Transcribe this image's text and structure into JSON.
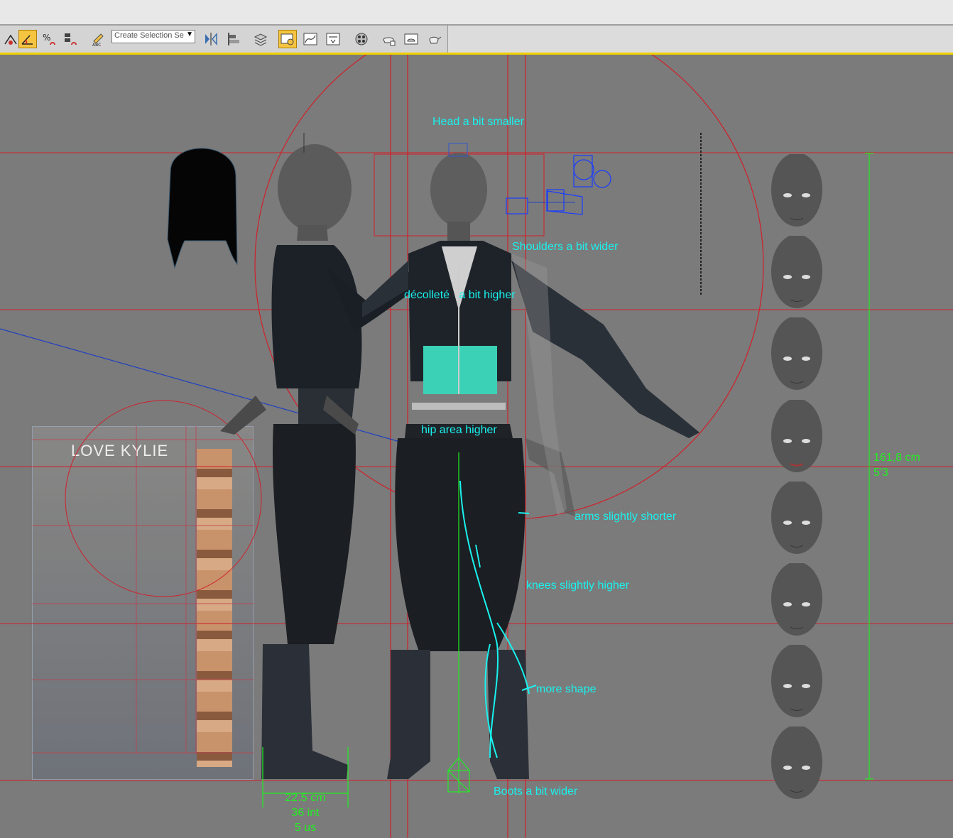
{
  "toolbar": {
    "selection_set_placeholder": "Create Selection Se",
    "tools": [
      {
        "name": "snap-2d-icon"
      },
      {
        "name": "angle-snap-icon"
      },
      {
        "name": "percent-snap-icon"
      },
      {
        "name": "spinner-snap-icon"
      },
      {
        "name": "edit-named-selection-icon"
      },
      {
        "name": "mirror-icon"
      },
      {
        "name": "align-icon"
      },
      {
        "name": "layer-manager-icon"
      },
      {
        "name": "scene-explorer-icon"
      },
      {
        "name": "curve-editor-icon"
      },
      {
        "name": "schematic-view-icon"
      },
      {
        "name": "material-editor-icon"
      },
      {
        "name": "render-setup-icon"
      },
      {
        "name": "rendered-frame-icon"
      },
      {
        "name": "render-teapot-icon"
      }
    ],
    "accent_color": "#f5c542"
  },
  "annotations": {
    "head": "Head a bit smaller",
    "shoulders": "Shoulders a bit wider",
    "decollete": "décolleté   a bit higher",
    "hip": "hip area higher",
    "arms": "arms slightly shorter",
    "knees": "knees slightly higher",
    "shape": "more shape",
    "boots": "Boots a bit wider"
  },
  "measurements": {
    "height_cm": "161,8 cm",
    "height_ft": "5'3",
    "foot_cm": "22.5 cm",
    "foot_int": "36 int",
    "foot_us": "5 us"
  },
  "reference": {
    "logo_text": "LOVE KYLIE"
  },
  "colors": {
    "annotation": "#19f2ee",
    "measure": "#22ee22",
    "guide_line": "#d0202a",
    "viewport_bg": "#7b7b7b"
  }
}
